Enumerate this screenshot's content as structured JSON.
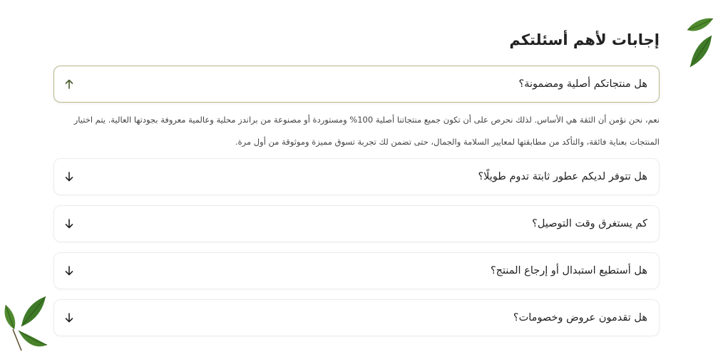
{
  "faq": {
    "title": "إجابات لأهم أسئلتكم",
    "items": [
      {
        "question": "هل منتجاتكم أصلية ومضمونة؟",
        "expanded": true,
        "answer": "نعم، نحن نؤمن أن الثقة هي الأساس. لذلك نحرص على أن تكون جميع منتجاتنا أصلية 100% ومستوردة أو مصنوعة من براندز محلية وعالمية معروفة بجودتها العالية. يتم اختيار المنتجات بعناية فائقة، والتأكد من مطابقتها لمعايير السلامة والجمال، حتى تضمن لك تجربة تسوق مميزة وموثوقة من أول مرة."
      },
      {
        "question": "هل تتوفر لديكم عطور ثابتة تدوم طويلًا؟",
        "expanded": false
      },
      {
        "question": "كم يستغرق وقت التوصيل؟",
        "expanded": false
      },
      {
        "question": "هل أستطيع استبدال أو إرجاع المنتج؟",
        "expanded": false
      },
      {
        "question": "هل تقدمون عروض وخصومات؟",
        "expanded": false
      }
    ]
  },
  "icons": {
    "expanded": "arrow-up-icon",
    "collapsed": "arrow-down-icon",
    "decoration": "leaf-icon"
  },
  "colors": {
    "accent_border": "#b9b98a",
    "accent_arrow": "#4a5a2a",
    "leaf_green": "#3f7a28"
  }
}
